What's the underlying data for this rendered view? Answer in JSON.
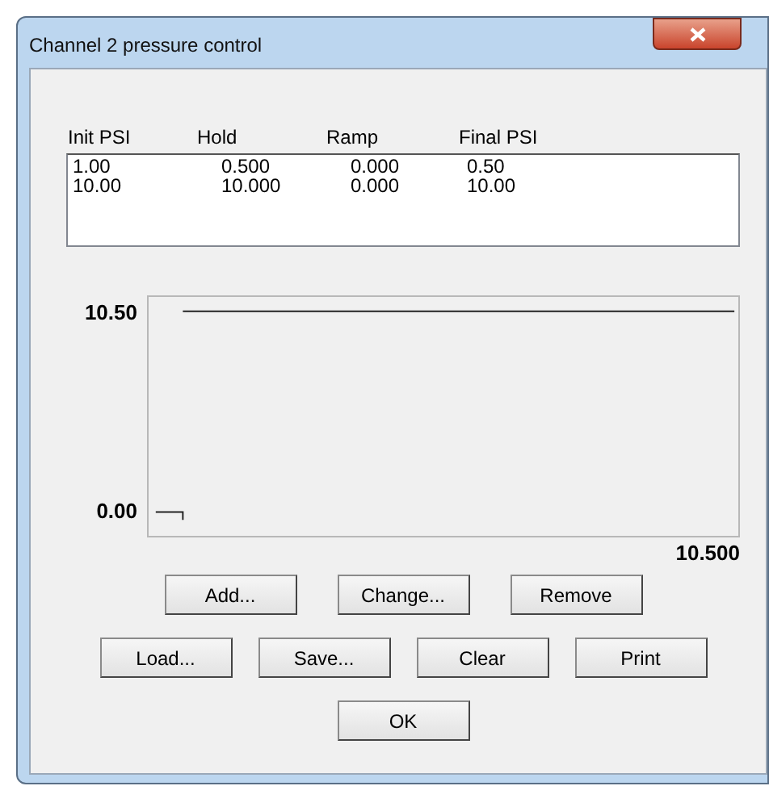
{
  "window": {
    "title": "Channel 2 pressure control"
  },
  "table": {
    "columns": [
      "Init PSI",
      "Hold",
      "Ramp",
      "Final PSI"
    ],
    "rows": [
      [
        "1.00",
        "0.500",
        "0.000",
        "0.50"
      ],
      [
        "10.00",
        "10.000",
        "0.000",
        "10.00"
      ]
    ]
  },
  "plot": {
    "y_max_label": "10.50",
    "y_min_label": "0.00",
    "x_max_label": "10.500"
  },
  "button_rows": [
    [
      "Add...",
      "Change...",
      "Remove"
    ],
    [
      "Load...",
      "Save...",
      "Clear",
      "Print"
    ],
    [
      "OK"
    ]
  ]
}
